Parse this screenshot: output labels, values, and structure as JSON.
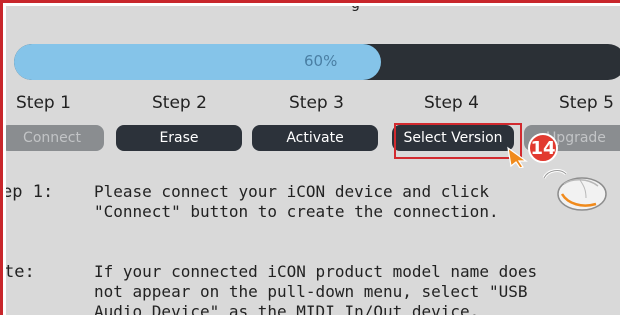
{
  "progress": {
    "value": 0.6,
    "label": "60%"
  },
  "top_fragment": "g",
  "steps": [
    {
      "label": "Step 1",
      "button": "Connect",
      "state": "disabled"
    },
    {
      "label": "Step 2",
      "button": "Erase",
      "state": "enabled"
    },
    {
      "label": "Step 3",
      "button": "Activate",
      "state": "enabled"
    },
    {
      "label": "Step 4",
      "button": "Select Version",
      "state": "enabled"
    },
    {
      "label": "Step 5",
      "button": "Upgrade",
      "state": "disabled"
    }
  ],
  "callout_number": "14",
  "info": [
    {
      "label": "ep 1:",
      "text": "Please connect your iCON device and click \"Connect\" button to create the connection."
    },
    {
      "label": "te:",
      "text": "If your connected iCON product model name does not appear on the pull-down menu, select \"USB Audio Device\" as the MIDI In/Out device."
    }
  ],
  "colors": {
    "highlight": "#d22a2f",
    "progress_fill": "#85c4e9",
    "button_bg": "#2c323a",
    "badge_bg": "#e23a30"
  }
}
